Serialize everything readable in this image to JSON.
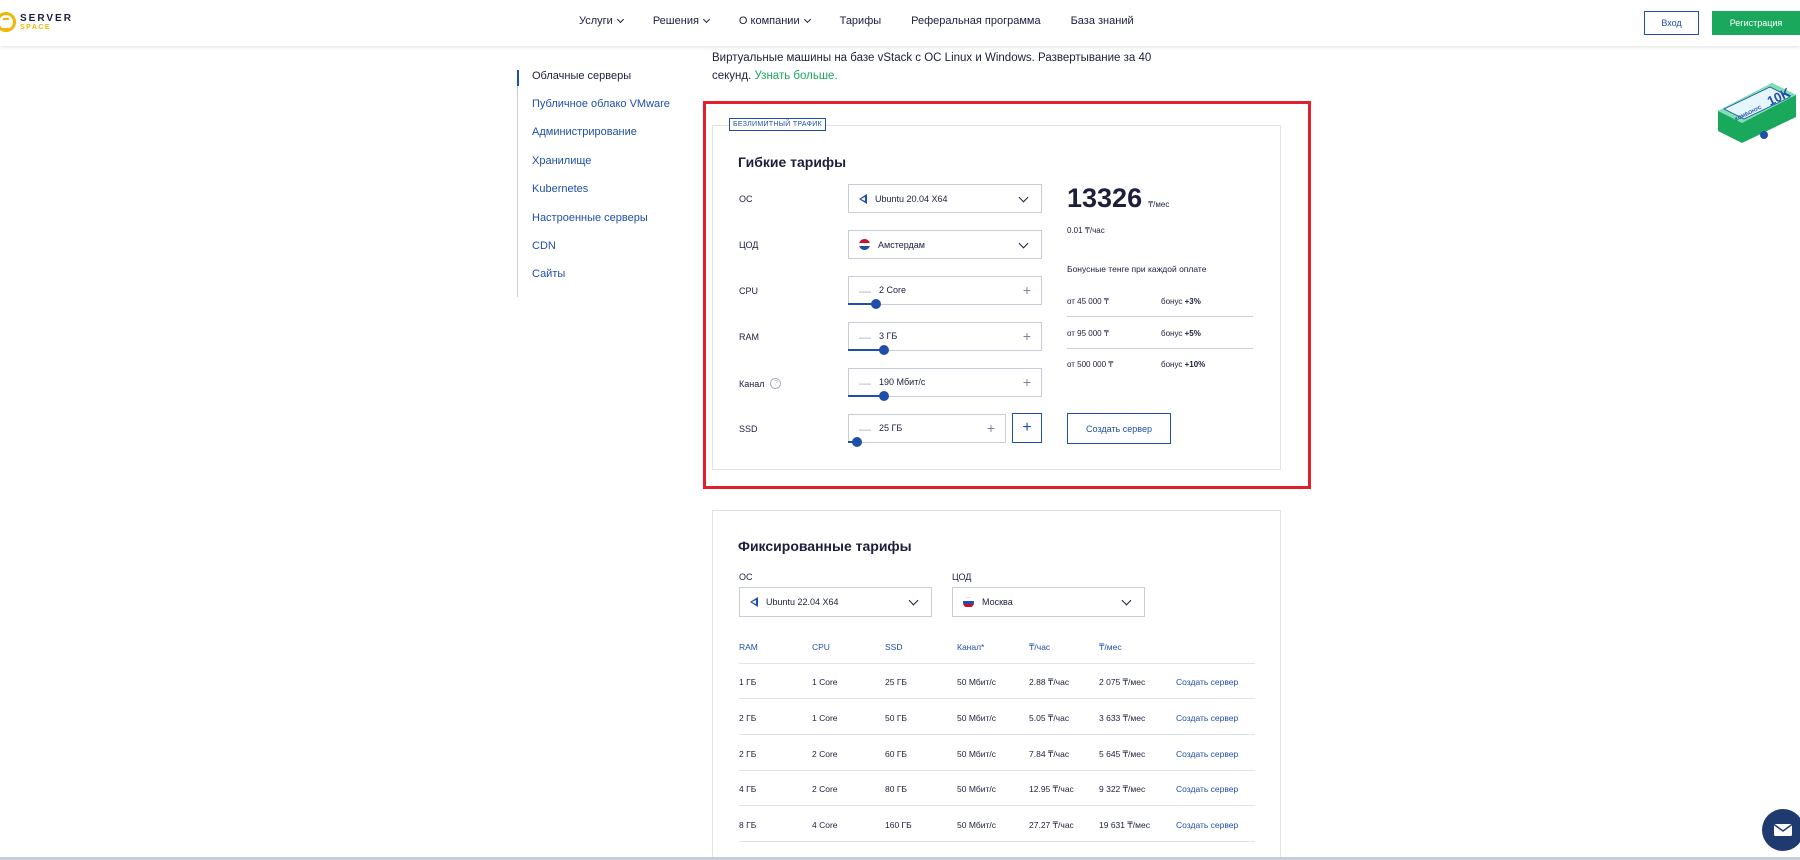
{
  "header": {
    "logo_top": "SERVER",
    "logo_bottom": "SPACE",
    "nav": [
      {
        "label": "Услуги",
        "dropdown": true
      },
      {
        "label": "Решения",
        "dropdown": true
      },
      {
        "label": "О компании",
        "dropdown": true
      },
      {
        "label": "Тарифы",
        "dropdown": false
      },
      {
        "label": "Реферальная программа",
        "dropdown": false
      },
      {
        "label": "База знаний",
        "dropdown": false
      }
    ],
    "login_label": "Вход",
    "register_label": "Регистрация"
  },
  "sidebar": {
    "items": [
      {
        "label": "Облачные серверы",
        "active": true
      },
      {
        "label": "Публичное облако VMware",
        "active": false
      },
      {
        "label": "Администрирование",
        "active": false
      },
      {
        "label": "Хранилище",
        "active": false
      },
      {
        "label": "Kubernetes",
        "active": false
      },
      {
        "label": "Настроенные серверы",
        "active": false
      },
      {
        "label": "CDN",
        "active": false
      },
      {
        "label": "Сайты",
        "active": false
      }
    ]
  },
  "intro": {
    "text": "Виртуальные машины на базе vStack с ОС Linux и Windows. Развертывание за 40 секунд.",
    "link": "Узнать больше."
  },
  "flex": {
    "badge": "БЕЗЛИМИТНЫЙ ТРАФИК",
    "title": "Гибкие тарифы",
    "os_label": "ОС",
    "os_value": "Ubuntu 20.04 X64",
    "dc_label": "ЦОД",
    "dc_value": "Амстердам",
    "cpu_label": "CPU",
    "cpu_value": "2 Core",
    "cpu_level": 0.11,
    "ram_label": "RAM",
    "ram_value": "3 ГБ",
    "ram_level": 0.15,
    "channel_label": "Канал",
    "channel_help": "?",
    "channel_value": "190 Мбит/с",
    "channel_level": 0.15,
    "ssd_label": "SSD",
    "ssd_value": "25 ГБ",
    "ssd_level": 0.0,
    "price": "13326",
    "price_unit": "₸/мес",
    "hourly": "0.01 ₸/час",
    "bonus_title": "Бонусные тенге при каждой оплате",
    "bonuses": [
      {
        "from": "от 45 000 ₸",
        "prefix": "бонус",
        "pct": "+3%"
      },
      {
        "from": "от 95 000 ₸",
        "prefix": "бонус",
        "pct": "+5%"
      },
      {
        "from": "от 500 000 ₸",
        "prefix": "бонус",
        "pct": "+10%"
      }
    ],
    "create_label": "Создать сервер"
  },
  "fixed": {
    "title": "Фиксированные тарифы",
    "os_label": "ОС",
    "os_value": "Ubuntu 22.04 X64",
    "dc_label": "ЦОД",
    "dc_value": "Москва",
    "columns": [
      "RAM",
      "CPU",
      "SSD",
      "Канал*",
      "₸/час",
      "₸/мес"
    ],
    "rows": [
      [
        "1 ГБ",
        "1 Core",
        "25 ГБ",
        "50 Мбит/с",
        "2.88 ₸/час",
        "2 075 ₸/мес",
        "Создать сервер"
      ],
      [
        "2 ГБ",
        "1 Core",
        "50 ГБ",
        "50 Мбит/с",
        "5.05 ₸/час",
        "3 633 ₸/мес",
        "Создать сервер"
      ],
      [
        "2 ГБ",
        "2 Core",
        "60 ГБ",
        "50 Мбит/с",
        "7.84 ₸/час",
        "5 645 ₸/мес",
        "Создать сервер"
      ],
      [
        "4 ГБ",
        "2 Core",
        "80 ГБ",
        "50 Мбит/с",
        "12.95 ₸/час",
        "9 322 ₸/мес",
        "Создать сервер"
      ],
      [
        "8 ГБ",
        "4 Core",
        "160 ГБ",
        "50 Мбит/с",
        "27.27 ₸/час",
        "19 631 ₸/мес",
        "Создать сервер"
      ]
    ]
  },
  "promo": {
    "text": "10K",
    "subtext": "КОМБОНУС"
  },
  "colors": {
    "accent": "#1f4fa8",
    "green": "#1aa85c",
    "red_frame": "#e0212b",
    "logo": "#f2b705"
  }
}
